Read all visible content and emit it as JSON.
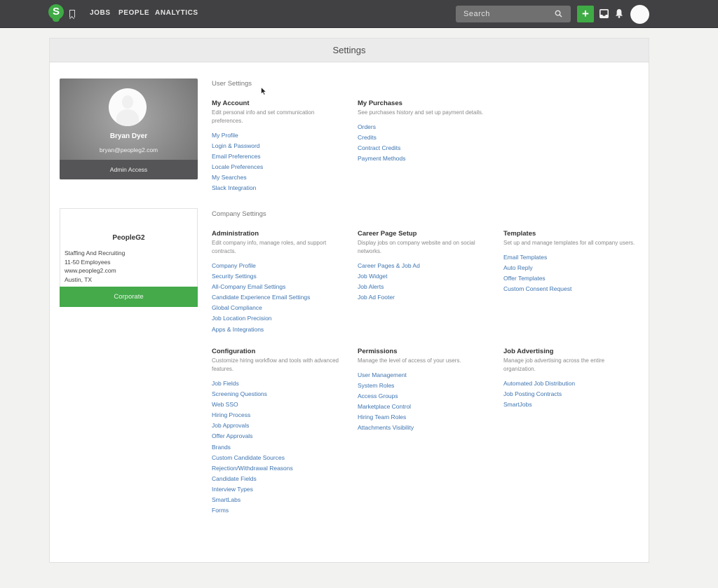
{
  "nav": {
    "logo_letter": "S",
    "links": [
      "JOBS",
      "PEOPLE",
      "ANALYTICS"
    ],
    "search_placeholder": "Search",
    "add_label": "+",
    "icons": [
      "bookmark-icon",
      "search-icon",
      "inbox-icon",
      "bell-icon",
      "avatar"
    ],
    "brand_color": "#3fab45",
    "bar_color": "#414042"
  },
  "page": {
    "title": "Settings"
  },
  "profile": {
    "name": "Bryan Dyer",
    "email": "bryan@peopleg2.com",
    "role": "Admin Access"
  },
  "company": {
    "name": "PeopleG2",
    "details": [
      "Staffing And Recruiting",
      "11-50 Employees",
      "www.peopleg2.com",
      "Austin, TX"
    ],
    "plan": "Corporate"
  },
  "user_settings": {
    "title": "User Settings",
    "groups": [
      {
        "title": "My Account",
        "description": "Edit personal info and set communication preferences.",
        "links": [
          "My Profile",
          "Login & Password",
          "Email Preferences",
          "Locale Preferences",
          "My Searches",
          "Slack Integration"
        ]
      },
      {
        "title": "My Purchases",
        "description": "See purchases history and set up payment details.",
        "links": [
          "Orders",
          "Credits",
          "Contract Credits",
          "Payment Methods"
        ]
      }
    ]
  },
  "company_settings": {
    "title": "Company Settings",
    "groups": [
      {
        "title": "Administration",
        "description": "Edit company info, manage roles, and support contracts.",
        "links": [
          "Company Profile",
          "Security Settings",
          "All-Company Email Settings",
          "Candidate Experience Email Settings",
          "Global Compliance",
          "Job Location Precision",
          "Apps & Integrations"
        ]
      },
      {
        "title": "Career Page Setup",
        "description": "Display jobs on company website and on social networks.",
        "links": [
          "Career Pages & Job Ad",
          "Job Widget",
          "Job Alerts",
          "Job Ad Footer"
        ]
      },
      {
        "title": "Templates",
        "description": "Set up and manage templates for all company users.",
        "links": [
          "Email Templates",
          "Auto Reply",
          "Offer Templates",
          "Custom Consent Request"
        ]
      },
      {
        "title": "Configuration",
        "description": "Customize hiring workflow and tools with advanced features.",
        "links": [
          "Job Fields",
          "Screening Questions",
          "Web SSO",
          "Hiring Process",
          "Job Approvals",
          "Offer Approvals",
          "Brands",
          "Custom Candidate Sources",
          "Rejection/Withdrawal Reasons",
          "Candidate Fields",
          "Interview Types",
          "SmartLabs",
          "Forms"
        ]
      },
      {
        "title": "Permissions",
        "description": "Manage the level of access of your users.",
        "links": [
          "User Management",
          "System Roles",
          "Access Groups",
          "Marketplace Control",
          "Hiring Team Roles",
          "Attachments Visibility"
        ]
      },
      {
        "title": "Job Advertising",
        "description": "Manage job advertising across the entire organization.",
        "links": [
          "Automated Job Distribution",
          "Job Posting Contracts",
          "SmartJobs"
        ]
      }
    ]
  }
}
